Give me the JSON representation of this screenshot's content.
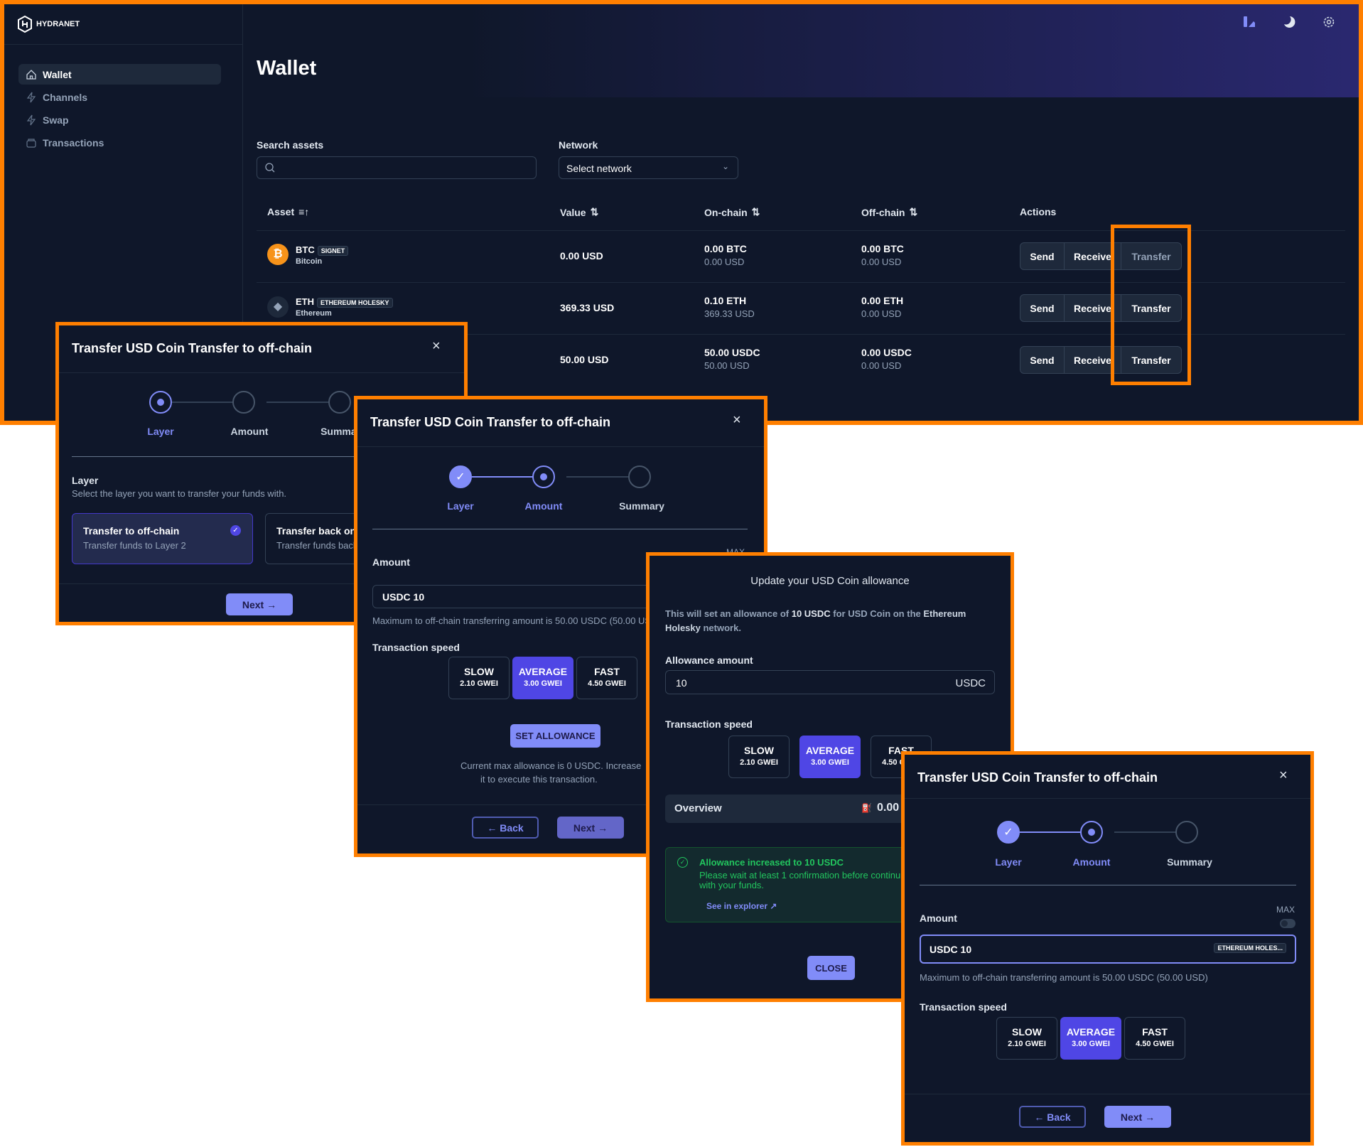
{
  "app": {
    "brand": "HYDRANET",
    "page_title": "Wallet"
  },
  "sidebar": {
    "items": [
      {
        "label": "Wallet",
        "icon": "home-icon",
        "active": true
      },
      {
        "label": "Channels",
        "icon": "lightning-icon"
      },
      {
        "label": "Swap",
        "icon": "lightning-icon"
      },
      {
        "label": "Transactions",
        "icon": "archive-icon"
      }
    ]
  },
  "header_icons": [
    "palette-icon",
    "moon-icon",
    "gear-icon"
  ],
  "filters": {
    "search_label": "Search assets",
    "search_placeholder": "",
    "network_label": "Network",
    "network_value": "Select network"
  },
  "table": {
    "headers": [
      "Asset",
      "Value",
      "On-chain",
      "Off-chain",
      "Actions"
    ],
    "rows": [
      {
        "symbol": "BTC",
        "badge": "SIGNET",
        "name": "Bitcoin",
        "value": "0.00 USD",
        "onchain": "0.00 BTC",
        "onchain_usd": "0.00 USD",
        "offchain": "0.00 BTC",
        "offchain_usd": "0.00 USD"
      },
      {
        "symbol": "ETH",
        "badge": "ETHEREUM HOLESKY",
        "name": "Ethereum",
        "value": "369.33 USD",
        "onchain": "0.10 ETH",
        "onchain_usd": "369.33 USD",
        "offchain": "0.00 ETH",
        "offchain_usd": "0.00 USD"
      },
      {
        "value": "50.00 USD",
        "onchain": "50.00 USDC",
        "onchain_usd": "50.00 USD",
        "offchain": "0.00 USDC",
        "offchain_usd": "0.00 USD"
      }
    ],
    "actions": {
      "send": "Send",
      "receive": "Receive",
      "transfer": "Transfer"
    }
  },
  "colors": {
    "accent": "#818cf8",
    "selected": "#4f46e5",
    "highlight": "#ff7f00",
    "background": "#0f172a",
    "success": "#22c55e"
  },
  "steps": [
    "Layer",
    "Amount",
    "Summary"
  ],
  "transfer_title": "Transfer USD Coin Transfer to off-chain",
  "layer_step": {
    "heading": "Layer",
    "description": "Select the layer you want to transfer your funds with.",
    "options": [
      {
        "title": "Transfer to off-chain",
        "subtitle": "Transfer funds to Layer 2",
        "selected": true
      },
      {
        "title": "Transfer back on-chain",
        "subtitle": "Transfer funds back to Layer 1"
      }
    ],
    "next": "Next →"
  },
  "amount_step": {
    "amount_label": "Amount",
    "max_label": "MAX",
    "amount_value": "USDC 10",
    "network_tag": "ETHEREUM HOLES...",
    "max_text": "Maximum to off-chain transferring amount is 50.00 USDC (50.00 USD)",
    "speed_label": "Transaction speed",
    "speeds": [
      {
        "name": "SLOW",
        "fee": "2.10 GWEI"
      },
      {
        "name": "AVERAGE",
        "fee": "3.00 GWEI",
        "selected": true
      },
      {
        "name": "FAST",
        "fee": "4.50 GWEI"
      }
    ],
    "set_allowance": "SET ALLOWANCE",
    "allowance_note_1": "Current max allowance is 0 USDC. Increase",
    "allowance_note_2": "it to execute this transaction.",
    "back": "← Back",
    "next": "Next →"
  },
  "allowance_dialog": {
    "title": "Update your USD Coin allowance",
    "desc_1": "This will set an allowance of ",
    "desc_amount": "10 USDC",
    "desc_2": " for USD Coin on the ",
    "desc_network": "Ethereum Holesky",
    "desc_3": " network.",
    "amount_label": "Allowance amount",
    "amount_value": "10",
    "amount_unit": "USDC",
    "overview_label": "Overview",
    "overview_fee": "0.00",
    "success_title": "Allowance increased to 10 USDC",
    "success_text": "Please wait at least 1 confirmation before continuing with your funds.",
    "explorer_link": "See in explorer",
    "close": "CLOSE"
  }
}
